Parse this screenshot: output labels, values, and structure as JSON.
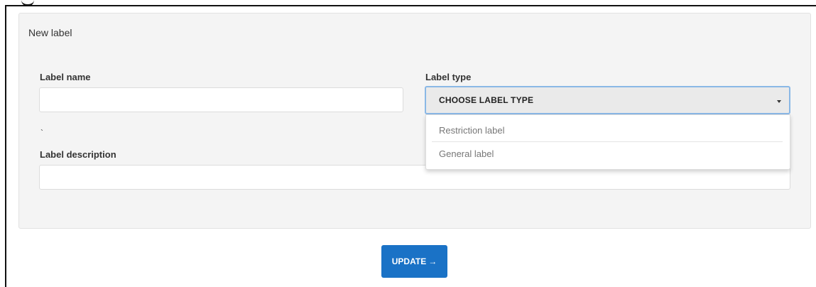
{
  "form": {
    "title": "New label",
    "label_name": {
      "label": "Label name",
      "value": "",
      "placeholder": ""
    },
    "label_type": {
      "label": "Label type",
      "selected": "CHOOSE LABEL TYPE",
      "options": [
        "Restriction label",
        "General label"
      ]
    },
    "stray_mark": "`",
    "label_description": {
      "label": "Label description",
      "value": "",
      "placeholder": ""
    }
  },
  "actions": {
    "update_label": "UPDATE",
    "update_icon": "→",
    "update_color": "#1a72c6"
  },
  "icons": {
    "select_caret": "chevron-down-icon",
    "update_arrow": "arrow-right-icon"
  }
}
